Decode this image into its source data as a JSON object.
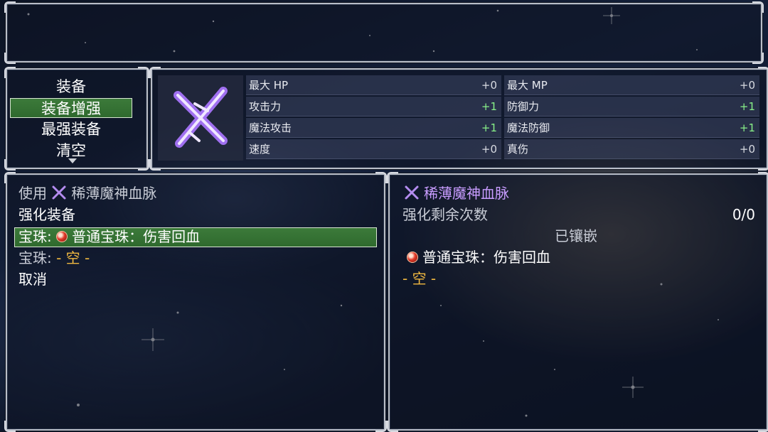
{
  "commands": {
    "items": [
      "装备",
      "装备增强",
      "最强装备",
      "清空"
    ],
    "selected_index": 1
  },
  "stats": {
    "rows": [
      {
        "left_label": "最大 HP",
        "left_value": "+0",
        "right_label": "最大 MP",
        "right_value": "+0"
      },
      {
        "left_label": "攻击力",
        "left_value": "+1",
        "right_label": "防御力",
        "right_value": "+1"
      },
      {
        "left_label": "魔法攻击",
        "left_value": "+1",
        "right_label": "魔法防御",
        "right_value": "+1"
      },
      {
        "left_label": "速度",
        "left_value": "+0",
        "right_label": "真伤",
        "right_value": "+0"
      }
    ],
    "colors": {
      "zero": "#d8dbe2",
      "up": "#88f088"
    }
  },
  "enhance": {
    "use_prefix": "使用",
    "item_name": "稀薄魔神血脉",
    "title": "强化装备",
    "gem_label": "宝珠:",
    "gem1_name": "普通宝珠：伤害回血",
    "gem2_empty": "- 空 -",
    "cancel": "取消"
  },
  "detail": {
    "item_name": "稀薄魔神血脉",
    "remaining_label": "强化剩余次数",
    "remaining_value": "0/0",
    "socketed_header": "已镶嵌",
    "socketed_gem": "普通宝珠：伤害回血",
    "empty_slot": "- 空 -"
  },
  "icons": {
    "item": "crossed-swords-purple-icon",
    "gem": "red-orb-icon"
  },
  "accent_colors": {
    "selection": "#3c7a3a",
    "item_purple": "#c89cff",
    "empty_orange": "#f0b840"
  }
}
